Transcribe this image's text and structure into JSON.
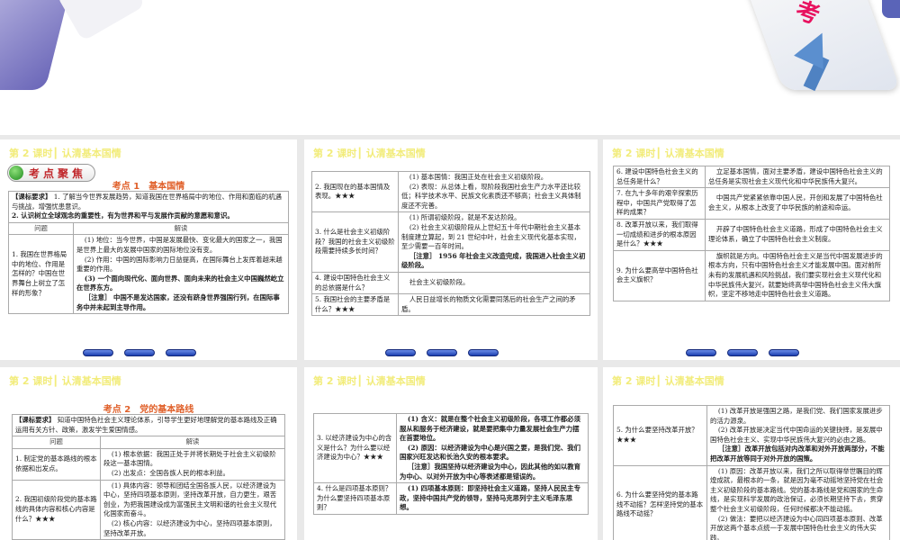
{
  "banner": {
    "deco_text": "考"
  },
  "slides": [
    {
      "header": "第 2 课时┃ 认清基本国情",
      "badge": "考点聚焦",
      "topic": "考点 1　基本国情",
      "requirement": [
        {
          "t": "【课标要求】",
          "b": true
        },
        {
          "t": " 1. 了解当今世界发展趋势，知道我国在世界格局中的地位、作用和面临的机遇与挑战，增强忧患意识。",
          "b": false
        },
        {
          "t": "2. 认识树立全球观念的重要性，有为世界和平与发展作贡献的意愿和意识。",
          "b": true,
          "br": true
        }
      ],
      "columns": [
        "问题",
        "解读"
      ],
      "rows": [
        {
          "q": "1. 我国在世界格局中的地位、作用是怎样的？中国在世界舞台上树立了怎样的形象？",
          "a": [
            {
              "t": "(1) 地位：当今世界，中国是发展最快、变化最大的国家之一，我国是世界上最大的发展中国家的国际地位没有变。"
            },
            {
              "t": "(2) 作用：中国的国际影响力日益提高，在国际舞台上发挥着越来越重要的作用。"
            },
            {
              "t": "(3) 一个面向现代化、面向世界、面向未来的社会主义中国巍然屹立在世界东方。",
              "b": true
            },
            {
              "t": "［注意］ 中国不是发达国家，还没有跻身世界强国行列，在国际事务中并未起到主导作用。",
              "b": true
            }
          ]
        }
      ]
    },
    {
      "header": "第 2 课时┃ 认清基本国情",
      "rows": [
        {
          "q": "2. 我国现在的基本国情及表现。★★★",
          "a": [
            {
              "t": "(1) 基本国情：我国正处在社会主义初级阶段。"
            },
            {
              "t": "(2) 表现：从总体上看，现阶段我国社会生产力水平还比较低；科学技术水平、民族文化素质还不够高；社会主义具体制度还不完善。"
            }
          ]
        },
        {
          "q": "3. 什么是社会主义初级阶段？我国的社会主义初级阶段需要持续多长时间？",
          "a": [
            {
              "t": "(1) 所谓初级阶段，就是不发达阶段。"
            },
            {
              "t": "(2) 社会主义初级阶段从上世纪五十年代中期社会主义基本制度建立算起，到 21 世纪中叶，社会主义现代化基本实现，至少需要一百年时间。"
            },
            {
              "t": "［注意］ 1956 年社会主义改造完成，我国进入社会主义初级阶段。",
              "b": true
            }
          ]
        },
        {
          "q": "4. 建设中国特色社会主义的总依据是什么？",
          "a": [
            {
              "t": "社会主义初级阶段。"
            }
          ]
        },
        {
          "q": "5. 我国社会的主要矛盾是什么？★★★",
          "a": [
            {
              "t": "人民日益增长的物质文化需要同落后的社会生产之间的矛盾。"
            }
          ]
        }
      ]
    },
    {
      "header": "第 2 课时┃ 认清基本国情",
      "rows": [
        {
          "q": "6. 建设中国特色社会主义的总任务是什么？",
          "a": [
            {
              "t": "立足基本国情，面对主要矛盾，建设中国特色社会主义的总任务是实现社会主义现代化和中华民族伟大复兴。"
            }
          ]
        },
        {
          "q": "7. 在九十多年的艰辛探索历程中，中国共产党取得了怎样的成果？",
          "a": [
            {
              "t": "中国共产党紧紧依靠中国人民，开创和发展了中国特色社会主义，从根本上改变了中华民族的前途和命运。"
            }
          ]
        },
        {
          "q": "8. 改革开放以来，我们取得一切成绩和进步的根本原因是什么？★★★",
          "a": [
            {
              "t": "开辟了中国特色社会主义道路，形成了中国特色社会主义理论体系，确立了中国特色社会主义制度。"
            }
          ]
        },
        {
          "q": "9. 为什么要高举中国特色社会主义旗帜？",
          "a": [
            {
              "t": "旗帜就是方向。中国特色社会主义是当代中国发展进步的根本方向，只有中国特色社会主义才能发展中国。面对前所未有的发展机遇和风险挑战，我们要实现社会主义现代化和中华民族伟大复兴，就要始终高举中国特色社会主义伟大旗帜，坚定不移地走中国特色社会主义道路。"
            }
          ]
        }
      ]
    },
    {
      "header": "第 2 课时┃ 认清基本国情",
      "topic": "考点 2　党的基本路线",
      "requirement": [
        {
          "t": "【课标要求】",
          "b": true
        },
        {
          "t": " 知道中国特色社会主义理论体系，引导学生更好地理解党的基本路线及正确运用有关方针、政策，激发学生爱国情感。",
          "b": false
        }
      ],
      "columns": [
        "问题",
        "解读"
      ],
      "rows": [
        {
          "q": "1. 制定党的基本路线的根本依据和出发点。",
          "a": [
            {
              "t": "(1) 根本依据：我国正处于并将长期处于社会主义初级阶段这一基本国情。"
            },
            {
              "t": "(2) 出发点：全国各族人民的根本利益。"
            }
          ]
        },
        {
          "q": "2. 我国初级阶段党的基本路线的具体内容和核心内容是什么？★★★",
          "a": [
            {
              "t": "(1) 具体内容：领导和团结全国各族人民，以经济建设为中心，坚持四项基本原则，坚持改革开放，自力更生，艰苦创业，为把我国建设成为富强民主文明和谐的社会主义现代化国家而奋斗。"
            },
            {
              "t": "(2) 核心内容：以经济建设为中心，坚持四项基本原则，坚持改革开放。"
            }
          ]
        }
      ]
    },
    {
      "header": "第 2 课时┃ 认清基本国情",
      "rows": [
        {
          "q": "3. 以经济建设为中心的含义是什么？为什么要以经济建设为中心？★★★",
          "a": [
            {
              "t": "(1) 含义：就是在整个社会主义初级阶段，各项工作都必须服从和服务于经济建设，就是要把集中力量发展社会生产力摆在首要地位。",
              "b": true
            },
            {
              "t": "(2) 原因：以经济建设为中心是兴国之要，是我们党、我们国家兴旺发达和长治久安的根本要求。",
              "b": true
            },
            {
              "t": "［注意］我国坚持以经济建设为中心，因此其他的如以教育为中心、以对外开放为中心等表述都是错误的。",
              "b": true
            }
          ]
        },
        {
          "q": "4. 什么是四项基本原则？为什么要坚持四项基本原则？",
          "a": [
            {
              "t": "(1) 四项基本原则：即坚持社会主义道路，坚持人民民主专政，坚持中国共产党的领导，坚持马克思列宁主义毛泽东思想。",
              "b": true
            }
          ]
        }
      ]
    },
    {
      "header": "第 2 课时┃ 认清基本国情",
      "rows": [
        {
          "q": "5. 为什么要坚持改革开放？★★★",
          "a": [
            {
              "t": "(1) 改革开放是强国之路，是我们党、我们国家发展进步的活力源泉。"
            },
            {
              "t": "(2) 改革开放是决定当代中国命运的关键抉择，是发展中国特色社会主义、实现中华民族伟大复兴的必由之路。"
            },
            {
              "t": "［注意］改革开放包括对内改革和对外开放两部分，不能把改革开放等同于对外开放的国策。",
              "b": true
            }
          ]
        },
        {
          "q": "6. 为什么要坚持党的基本路线不动摇？怎样坚持党的基本路线不动摇？",
          "a": [
            {
              "t": "(1) 原因：改革开放以来，我们之所以取得举世瞩目的辉煌成就，最根本的一条，就是因为毫不动摇地坚持党在社会主义初级阶段的基本路线。党的基本路线是党和国家的生命线，是实现科学发展的政治保证，必须长期坚持下去，贯穿整个社会主义初级阶段，任何时候都决不能动摇。"
            },
            {
              "t": "(2) 做法：要把以经济建设为中心同四项基本原则、改革开放这两个基本点统一于发展中国特色社会主义的伟大实践。"
            }
          ]
        }
      ]
    }
  ]
}
